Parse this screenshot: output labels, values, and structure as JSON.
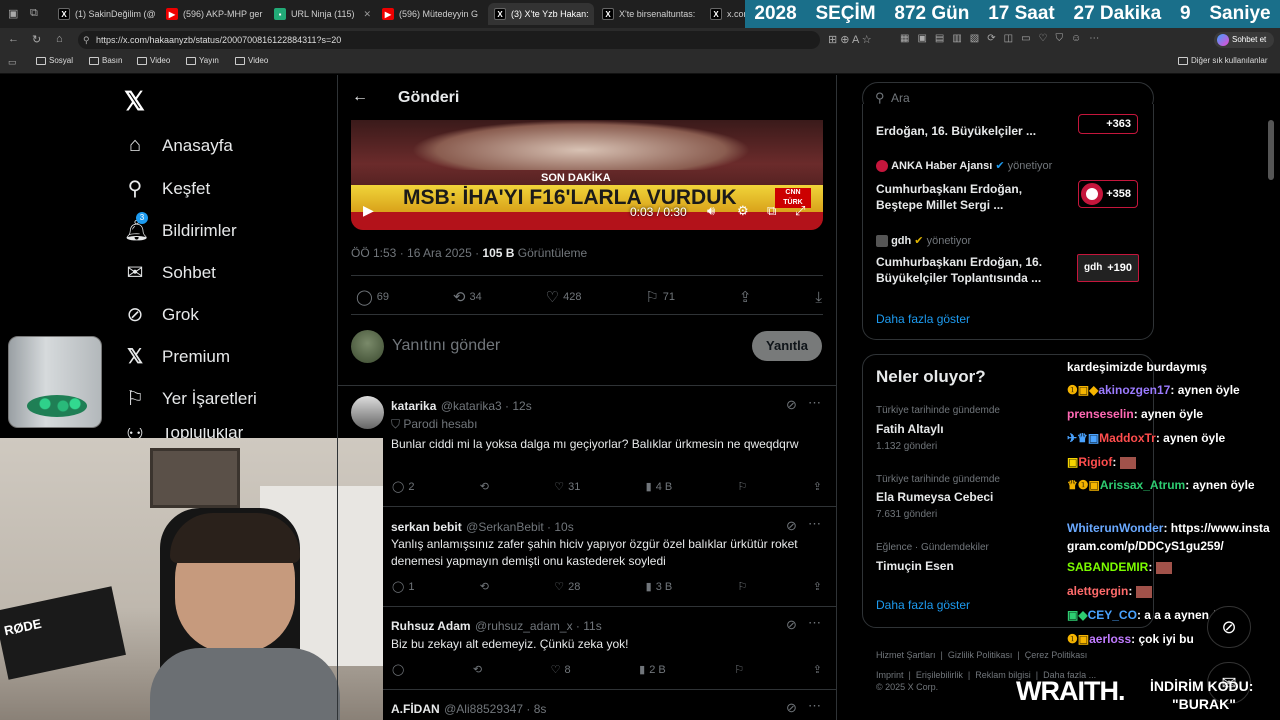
{
  "browser": {
    "tabs": [
      {
        "label": "(1) SakinDeğilim (@",
        "fav": "X",
        "favColor": "#000"
      },
      {
        "label": "(596) AKP-MHP ger",
        "fav": "▶",
        "favColor": "#e00"
      },
      {
        "label": "URL Ninja (115)",
        "fav": "▪",
        "favColor": "#2a7"
      },
      {
        "label": "(596) Mütedeyyin G",
        "fav": "▶",
        "favColor": "#e00"
      },
      {
        "label": "(3) X'te Yzb Hakan:",
        "fav": "X",
        "favColor": "#000"
      },
      {
        "label": "X'te birsenaltuntas:",
        "fav": "X",
        "favColor": "#000"
      },
      {
        "label": "x.com",
        "fav": "X",
        "favColor": "#000"
      }
    ],
    "countdown": [
      "2028",
      "SEÇİM",
      "872 Gün",
      "17 Saat",
      "27 Dakika",
      "9",
      "Saniye"
    ],
    "url": "https://x.com/hakaanyzb/status/2000700816122884311?s=20",
    "chat_button": "Sohbet et",
    "bookmarks": [
      "Sosyal",
      "Basın",
      "Video",
      "Yayın",
      "Video"
    ],
    "other_bookmarks": "Diğer sık kullanılanlar"
  },
  "nav": {
    "items": [
      "Anasayfa",
      "Keşfet",
      "Bildirimler",
      "Sohbet",
      "Grok",
      "Premium",
      "Yer İşaretleri",
      "Topluluklar"
    ],
    "notif_badge": "3"
  },
  "post": {
    "header_title": "Gönderi",
    "video_caption_top": "SON DAKİKA",
    "video_headline": "MSB: İHA'YI F16'LARLA VURDUK",
    "video_logo": "CNN TÜRK",
    "video_time": "0:03 / 0:30",
    "timestamp": "ÖÖ 1:53 · 16 Ara 2025 · ",
    "views_count": "105 B",
    "views_label": "Görüntüleme",
    "replies": "69",
    "reposts": "34",
    "likes": "428",
    "bookmarks": "71",
    "reply_placeholder": "Yanıtını gönder",
    "reply_button": "Yanıtla"
  },
  "replies": [
    {
      "name": "katarika",
      "handle": "@katarika3 · 12s",
      "badge": "Parodi hesabı",
      "text": "Bunlar ciddi mi la yoksa dalga mı geçiyorlar? Balıklar ürkmesin ne qweqdqrw",
      "replies": "2",
      "likes": "31",
      "views": "4 B"
    },
    {
      "name": "serkan bebit",
      "handle": "@SerkanBebit · 10s",
      "text": "Yanlış anlamışsınız zafer şahin hiciv yapıyor özgür özel balıklar ürkütür roket denemesi yapmayın demişti onu kastederek soyledi",
      "replies": "1",
      "likes": "28",
      "views": "3 B"
    },
    {
      "name": "Ruhsuz Adam",
      "handle": "@ruhsuz_adam_x · 11s",
      "text": "Biz bu zekayı alt edemeyiz. Çünkü zeka yok!",
      "replies": "",
      "likes": "8",
      "views": "2 B"
    },
    {
      "name": "A.FİDAN",
      "handle": "@Ali88529347 · 8s"
    }
  ],
  "right": {
    "search_placeholder": "Ara",
    "news": [
      {
        "source": "",
        "title": "Erdoğan, 16. Büyükelçiler ...",
        "count": "+363"
      },
      {
        "source": "ANKA Haber Ajansı",
        "managing": "yönetiyor",
        "title": "Cumhurbaşkanı Erdoğan, Beştepe Millet Sergi ...",
        "count": "+358"
      },
      {
        "source": "gdh",
        "managing": "yönetiyor",
        "title": "Cumhurbaşkanı Erdoğan, 16. Büyükelçiler Toplantısında ...",
        "count": "+190"
      }
    ],
    "show_more": "Daha fazla göster",
    "trends_title": "Neler oluyor?",
    "trends": [
      {
        "meta": "Türkiye tarihinde gündemde",
        "title": "Fatih Altaylı",
        "sub": "1.132 gönderi"
      },
      {
        "meta": "Türkiye tarihinde gündemde",
        "title": "Ela Rumeysa Cebeci",
        "sub": "7.631 gönderi"
      },
      {
        "meta": "Eğlence · Gündemdekiler",
        "title": "Timuçin Esen",
        "sub": ""
      }
    ],
    "footer": [
      "Hizmet Şartları",
      "Gizlilik Politikası",
      "Çerez Politikası",
      "Imprint",
      "Erişilebilirlik",
      "Reklam bilgisi",
      "Daha fazla ...",
      "© 2025 X Corp."
    ]
  },
  "stream_chat": [
    {
      "user": "",
      "msg": "kardeşimizde burdaymış",
      "color": "#fff"
    },
    {
      "user": "akinozgen17",
      "msg": "aynen öyle",
      "color": "#9b7bff"
    },
    {
      "user": "prenseselin",
      "msg": "aynen öyle",
      "color": "#ff69b4"
    },
    {
      "user": "MaddoxTr",
      "msg": "aynen öyle",
      "color": "#ff4d4d"
    },
    {
      "user": "Rigiof",
      "msg": "",
      "color": "#ff4d4d"
    },
    {
      "user": "Arissax_Atrum",
      "msg": "aynen öyle",
      "color": "#2ecc71"
    },
    {
      "user": "WhiterunWonder",
      "msg": "https://www.instagram.com/p/DDCyS1gu259/",
      "color": "#6aa9ff"
    },
    {
      "user": "SABANDEMIR",
      "msg": "",
      "color": "#7CFC00"
    },
    {
      "user": "alettgergin",
      "msg": "",
      "color": "#ff6b6b"
    },
    {
      "user": "CEY_CO",
      "msg": "a a a aynen öyle",
      "color": "#4aa3ff"
    },
    {
      "user": "aerloss",
      "msg": "çok iyi bu",
      "color": "#c07bff"
    }
  ],
  "sponsor": {
    "brand": "WRAITH.",
    "text1": "İNDİRİM KODU:",
    "code": "\"BURAK\""
  }
}
